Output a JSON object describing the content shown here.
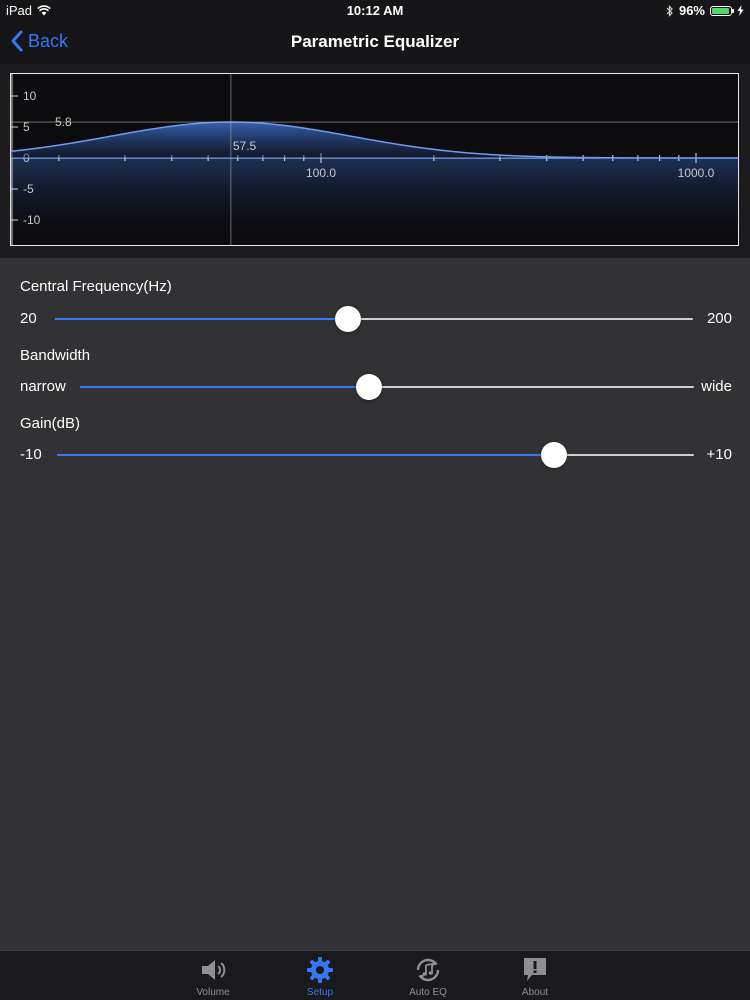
{
  "status_bar": {
    "device": "iPad",
    "time": "10:12 AM",
    "battery_text": "96%",
    "battery_level": 0.96,
    "battery_color": "#4cd964"
  },
  "nav": {
    "back_label": "Back",
    "title": "Parametric Equalizer"
  },
  "eq_graph": {
    "y_ticks": [
      "10",
      "5",
      "0",
      "-5",
      "-10"
    ],
    "y_values": [
      10,
      5,
      0,
      -5,
      -10
    ],
    "x_labels": [
      "100.0",
      "1000.0"
    ],
    "peak_gain_label": "5.8",
    "peak_freq_label": "57.5",
    "peak_gain": 5.8,
    "peak_freq": 57.5,
    "y_range": [
      -14,
      14
    ],
    "x_range_hz": [
      10,
      1500
    ],
    "curve_color": "#3f6fd0",
    "line_color": "#8fb4ff"
  },
  "controls": {
    "frequency": {
      "label": "Central Frequency(Hz)",
      "min_label": "20",
      "max_label": "200",
      "position": 0.46
    },
    "bandwidth": {
      "label": "Bandwidth",
      "min_label": "narrow",
      "max_label": "wide",
      "position": 0.47
    },
    "gain": {
      "label": "Gain(dB)",
      "min_label": "-10",
      "max_label": "+10",
      "position": 0.78
    }
  },
  "tabs": [
    {
      "label": "Volume",
      "icon": "speaker-icon",
      "active": false
    },
    {
      "label": "Setup",
      "icon": "gear-icon",
      "active": true
    },
    {
      "label": "Auto EQ",
      "icon": "auto-eq-icon",
      "active": false
    },
    {
      "label": "About",
      "icon": "about-icon",
      "active": false
    }
  ],
  "colors": {
    "accent": "#3478f6",
    "inactive_tab": "#8e8e93"
  }
}
